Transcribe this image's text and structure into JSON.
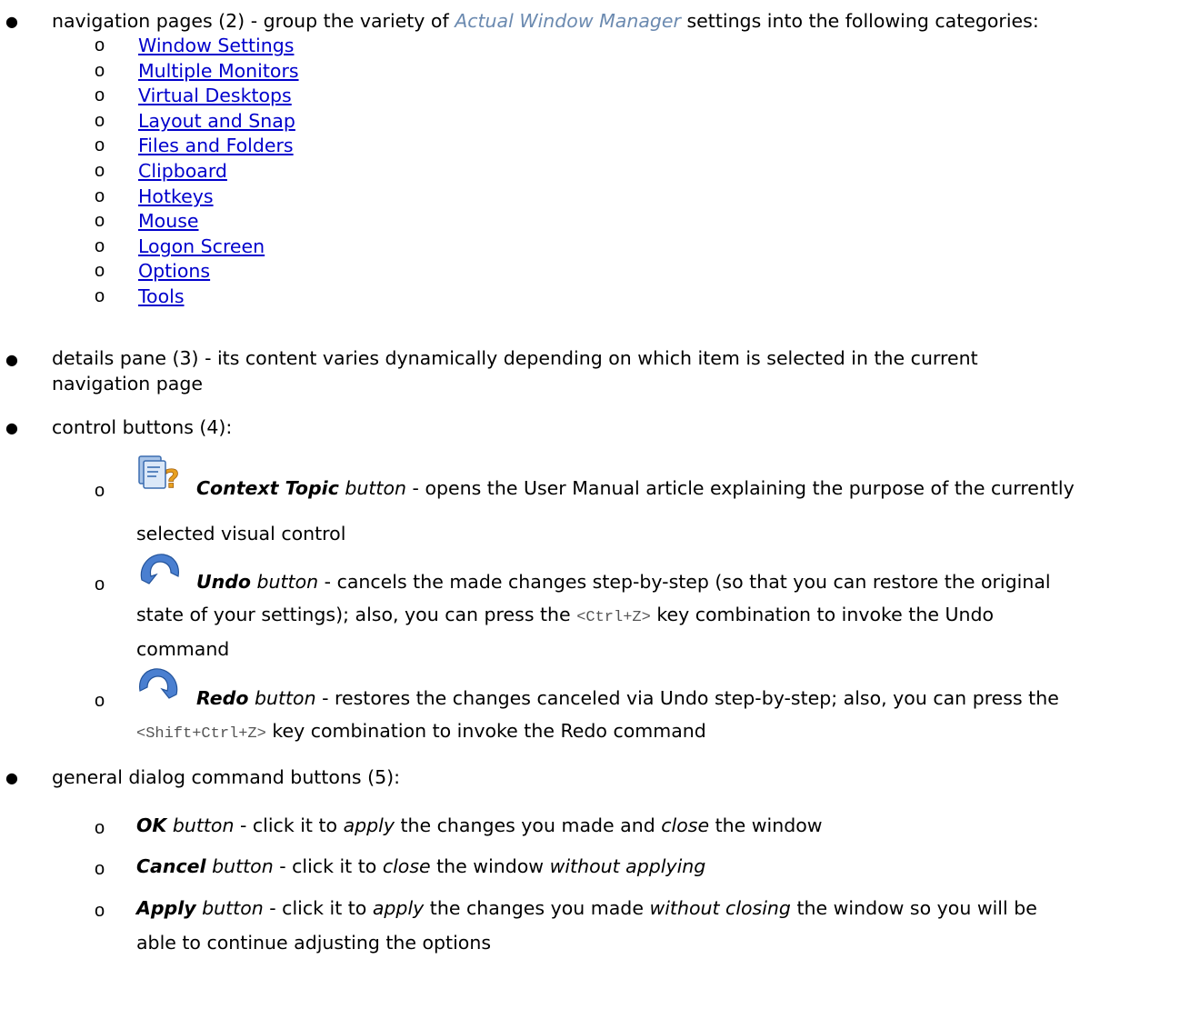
{
  "item2": {
    "prefix": "navigation pages (2) - group the variety of ",
    "app": "Actual Window Manager",
    "suffix": " settings into the following categories:",
    "links": [
      "Window Settings",
      "Multiple Monitors",
      "Virtual Desktops",
      "Layout and Snap",
      "Files and Folders",
      "Clipboard",
      "Hotkeys",
      "Mouse",
      "Logon Screen",
      "Options",
      "Tools"
    ]
  },
  "item3": {
    "line1": "details pane (3) - its content varies dynamically depending on which item is selected in the current",
    "line2": "navigation page"
  },
  "item4": {
    "title": "control buttons (4):",
    "context": {
      "name": "Context Topic",
      "btn": " button",
      "desc": " - opens the User Manual article explaining the purpose of the currently",
      "line2": "selected visual control",
      "icon": "context-topic-icon"
    },
    "undo": {
      "name": "Undo",
      "btn": " button",
      "desc": " - cancels the made changes step-by-step (so that you can restore the original",
      "line2a": "state of your settings); also, you can press the ",
      "key": "<Ctrl+Z>",
      "line2b": " key combination to invoke the Undo",
      "line3": "command",
      "icon": "undo-icon"
    },
    "redo": {
      "name": "Redo",
      "btn": " button",
      "desc": " - restores the changes canceled via Undo step-by-step; also, you can press the",
      "key": "<Shift+Ctrl+Z>",
      "line2b": " key combination to invoke the Redo command",
      "icon": "redo-icon"
    }
  },
  "item5": {
    "title": "general dialog command buttons (5):",
    "ok": {
      "name": "OK",
      "btn": " button",
      "t1": " - click it to ",
      "apply": "apply",
      "t2": " the changes you made and ",
      "close": "close",
      "t3": " the window"
    },
    "cancel": {
      "name": "Cancel",
      "btn": " button",
      "t1": " - click it to ",
      "close": "close",
      "t2": " the window ",
      "without": "without applying"
    },
    "apply": {
      "name": "Apply",
      "btn": " button",
      "t1": " - click it to ",
      "apply": "apply",
      "t2": " the changes you made ",
      "without": "without closing",
      "t3": " the window so you will be",
      "line2": "able to continue adjusting the options"
    }
  }
}
